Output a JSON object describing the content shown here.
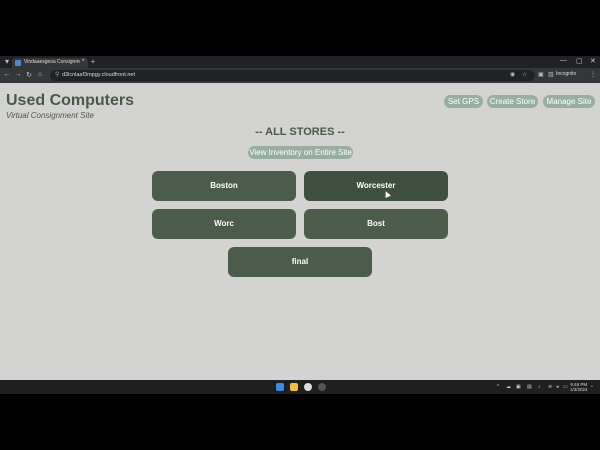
{
  "browser": {
    "tab_title": "Vindaaesgesa Consignment",
    "new_tab": "+",
    "close_tab": "×",
    "url": "d3lcnlaaf3mpgy.cloudfront.net",
    "profile": "Incognito",
    "window_controls": {
      "minimize": "—",
      "maximize": "▢",
      "close": "✕"
    }
  },
  "header": {
    "title": "Used Computers",
    "subtitle": "Virtual Consignment Site",
    "actions": [
      "Set GPS",
      "Create Store",
      "Manage Site"
    ]
  },
  "main": {
    "heading": "-- ALL STORES --",
    "view_inventory": "View Inventory on Entire Site",
    "stores": [
      "Boston",
      "Worcester",
      "Worc",
      "Bost",
      "final"
    ]
  },
  "taskbar": {
    "time": "9:46 PM",
    "date": "1/3/2024"
  },
  "colors": {
    "page_bg": "#d3d4d1",
    "accent_green": "#4c5c4a",
    "pill_bg": "#98aea3"
  }
}
